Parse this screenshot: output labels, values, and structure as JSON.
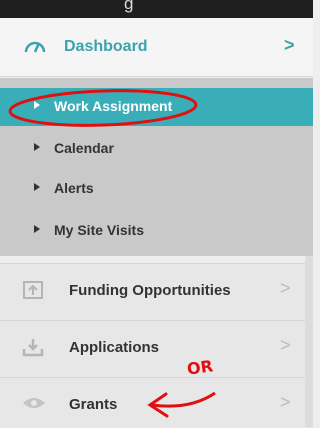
{
  "window": {
    "title_fragment": "g"
  },
  "dashboard": {
    "label": "Dashboard",
    "icon": "speedometer-icon",
    "chevron": ">"
  },
  "submenu": [
    {
      "label": "Work Assignment",
      "active": true
    },
    {
      "label": "Calendar",
      "active": false
    },
    {
      "label": "Alerts",
      "active": false
    },
    {
      "label": "My Site Visits",
      "active": false
    }
  ],
  "menu_items": [
    {
      "label": "Funding Opportunities",
      "icon": "upload-tray-icon",
      "chevron": ">"
    },
    {
      "label": "Applications",
      "icon": "download-tray-icon",
      "chevron": ">"
    },
    {
      "label": "Grants",
      "icon": "eye-icon",
      "chevron": ">"
    }
  ],
  "annotation": {
    "text": "OR",
    "color": "#e01010"
  },
  "colors": {
    "accent": "#3aa3ad",
    "active_bg": "#3aaeb8",
    "submenu_bg": "#c9c9c9",
    "item_bg": "#e7e7e7"
  }
}
